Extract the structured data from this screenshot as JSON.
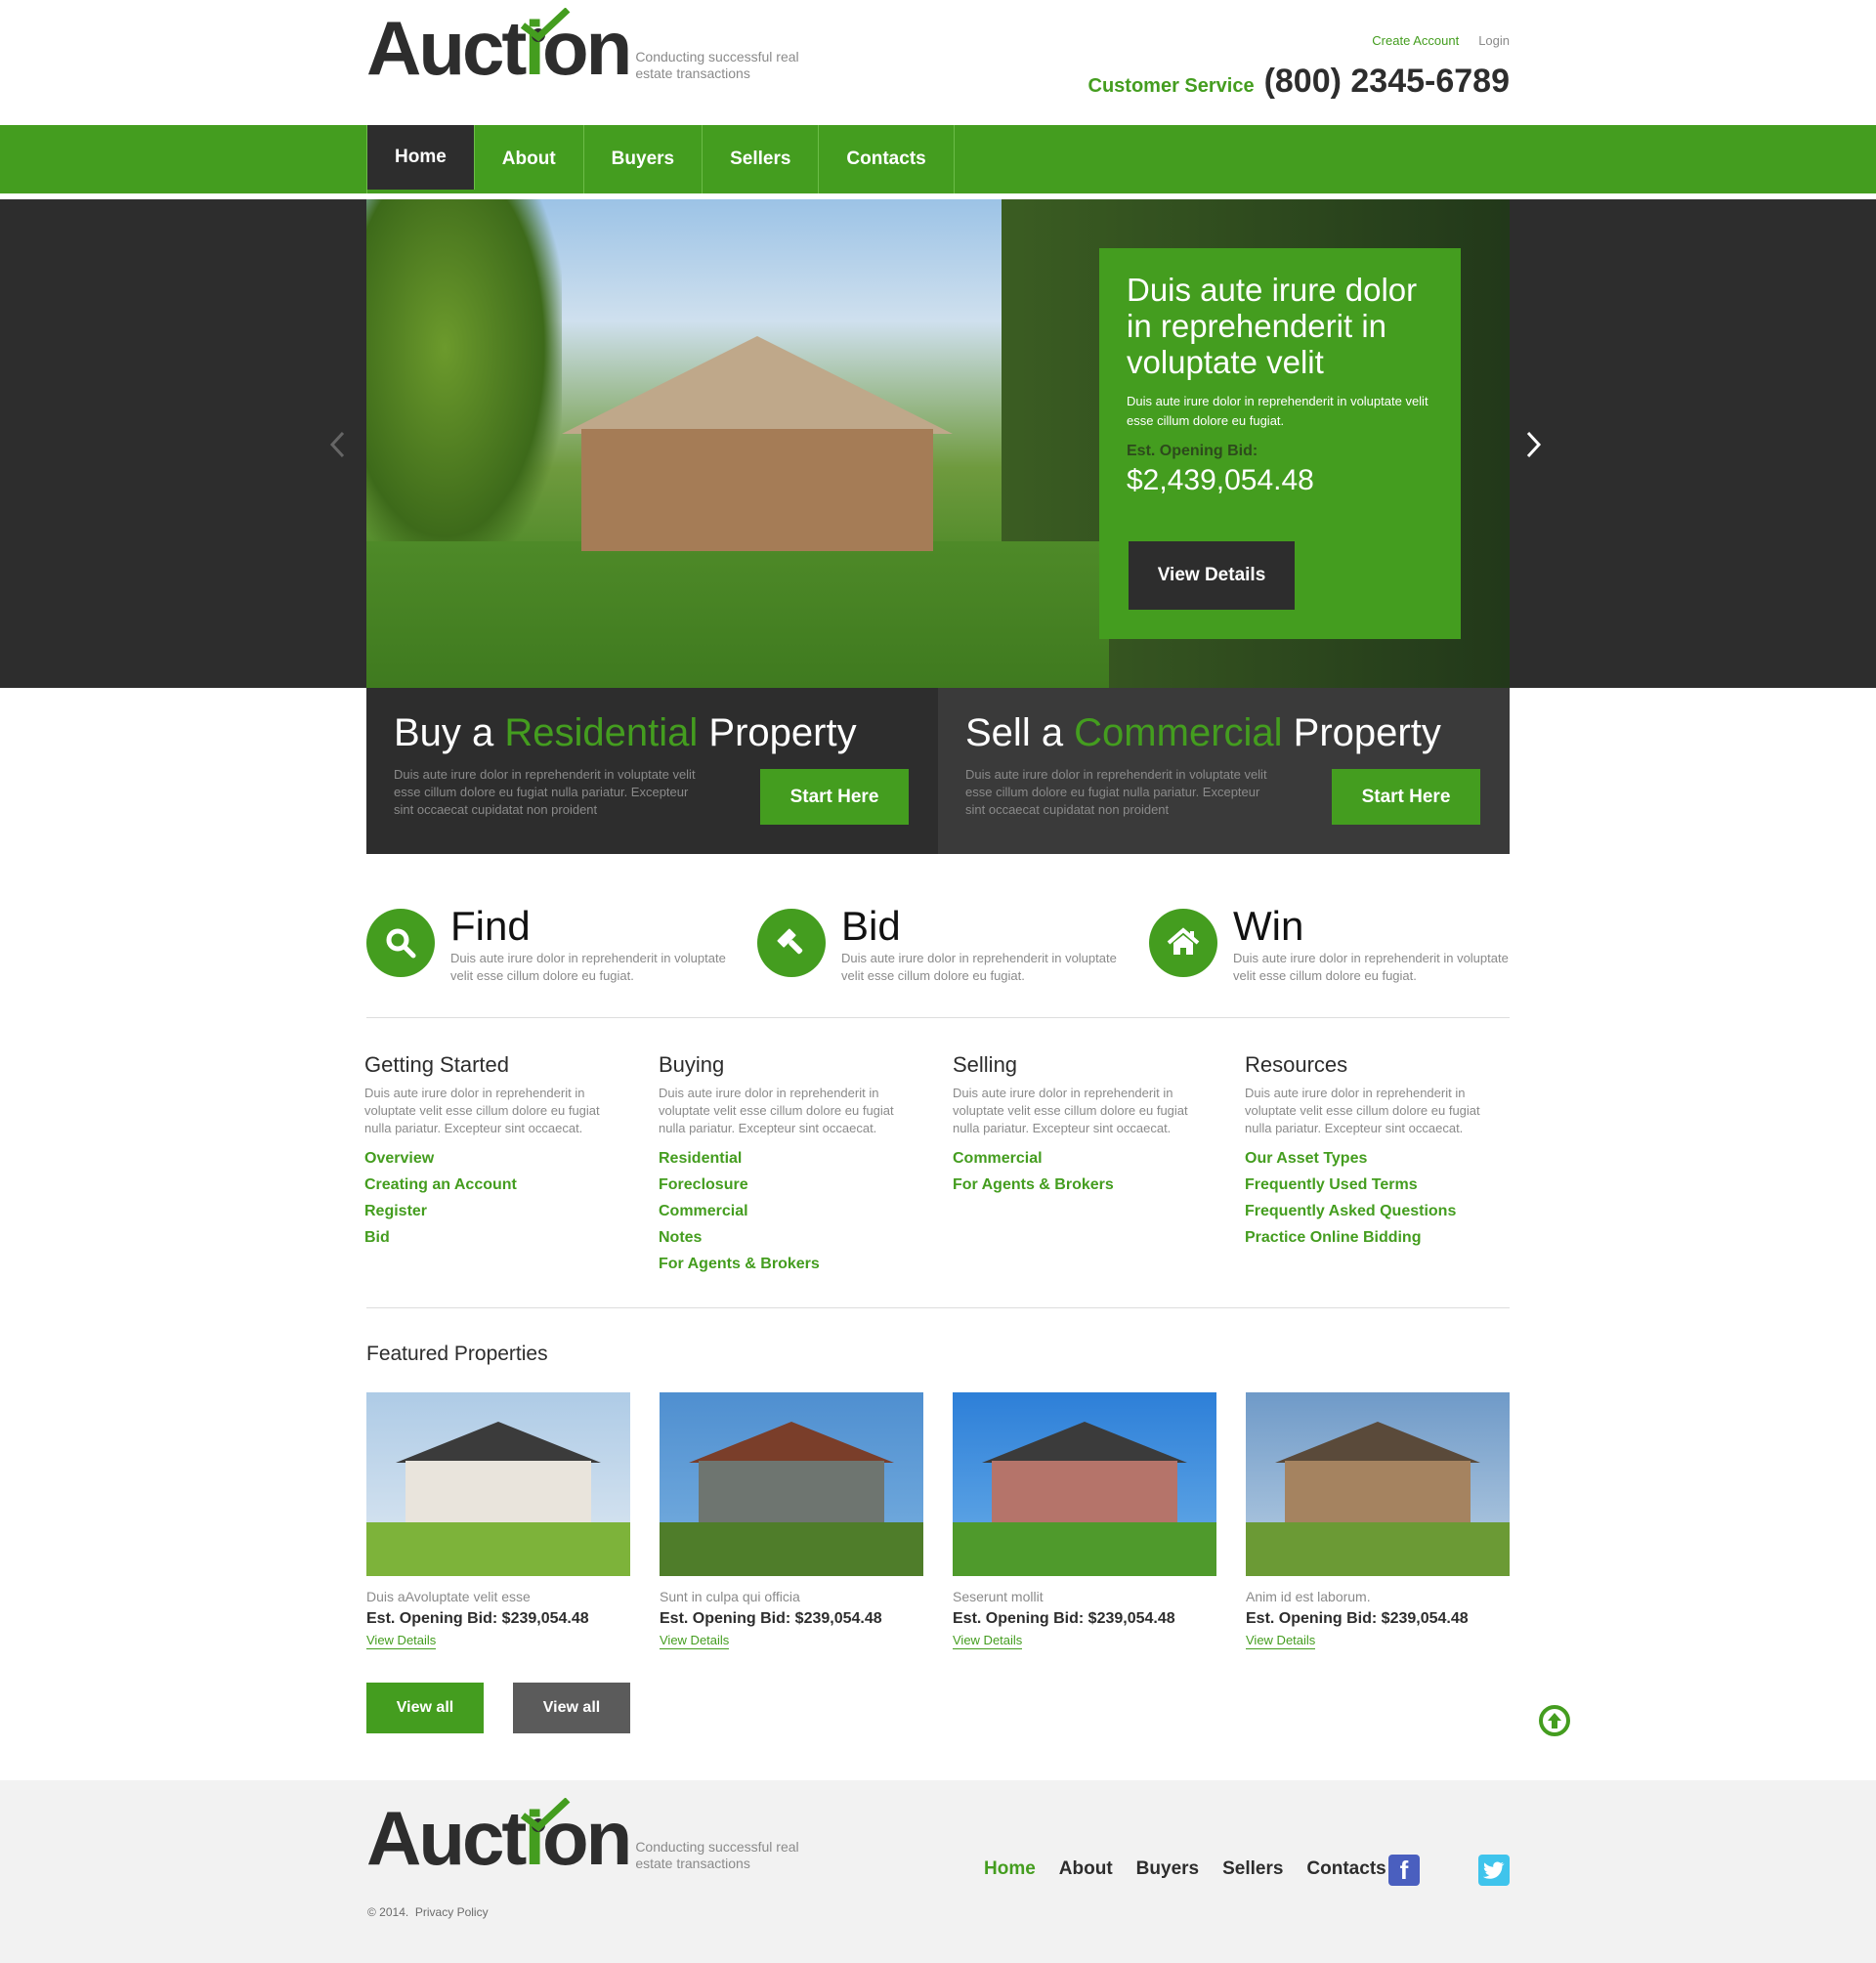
{
  "brand": {
    "logo_main": "Auct",
    "logo_i": "i",
    "logo_end": "on",
    "tagline_line1": "Conducting successful real",
    "tagline_line2": "estate transactions"
  },
  "header": {
    "create_account": "Create Account",
    "login": "Login",
    "customer_service_label": "Customer Service",
    "phone": "(800) 2345-6789"
  },
  "nav": {
    "items": [
      {
        "label": "Home",
        "active": true
      },
      {
        "label": "About"
      },
      {
        "label": "Buyers"
      },
      {
        "label": "Sellers"
      },
      {
        "label": "Contacts"
      }
    ]
  },
  "hero": {
    "title": "Duis aute irure dolor in reprehenderit in voluptate velit",
    "description": "Duis aute irure dolor in reprehenderit in voluptate velit esse cillum dolore eu fugiat.",
    "bid_label": "Est. Opening Bid:",
    "bid_value": "$2,439,054.48",
    "button": "View Details",
    "prev_icon": "chevron-left",
    "next_icon": "chevron-right"
  },
  "cta": {
    "buy": {
      "prefix": "Buy a ",
      "highlight": "Residential",
      "suffix": " Property",
      "description": "Duis aute irure dolor in reprehenderit in voluptate velit esse cillum dolore eu fugiat nulla pariatur. Excepteur sint occaecat cupidatat non proident",
      "button": "Start Here"
    },
    "sell": {
      "prefix": "Sell a ",
      "highlight": "Commercial",
      "suffix": " Property",
      "description": "Duis aute irure dolor in reprehenderit in voluptate velit esse cillum dolore eu fugiat nulla pariatur. Excepteur sint occaecat cupidatat non proident",
      "button": "Start Here"
    }
  },
  "features": [
    {
      "title": "Find",
      "icon": "search-icon",
      "description": "Duis aute irure dolor in reprehenderit in voluptate velit esse cillum dolore eu fugiat."
    },
    {
      "title": "Bid",
      "icon": "gavel-icon",
      "description": "Duis aute irure dolor in reprehenderit in voluptate velit esse cillum dolore eu fugiat."
    },
    {
      "title": "Win",
      "icon": "home-icon",
      "description": "Duis aute irure dolor in reprehenderit in voluptate velit esse cillum dolore eu fugiat."
    }
  ],
  "columns": [
    {
      "title": "Getting Started",
      "description": "Duis aute irure dolor in reprehenderit in voluptate velit esse cillum dolore eu fugiat nulla pariatur. Excepteur sint occaecat.",
      "links": [
        "Overview",
        "Creating an Account",
        "Register",
        "Bid"
      ]
    },
    {
      "title": "Buying",
      "description": "Duis aute irure dolor in reprehenderit in voluptate velit esse cillum dolore eu fugiat nulla pariatur. Excepteur sint occaecat.",
      "links": [
        "Residential",
        "Foreclosure",
        "Commercial",
        "Notes",
        "For Agents & Brokers"
      ]
    },
    {
      "title": "Selling",
      "description": "Duis aute irure dolor in reprehenderit in voluptate velit esse cillum dolore eu fugiat nulla pariatur. Excepteur sint occaecat.",
      "links": [
        "Commercial",
        "For Agents & Brokers"
      ]
    },
    {
      "title": "Resources",
      "description": "Duis aute irure dolor in reprehenderit in voluptate velit esse cillum dolore eu fugiat nulla pariatur. Excepteur sint occaecat.",
      "links": [
        "Our Asset Types",
        "Frequently Used Terms",
        "Frequently Asked Questions",
        "Practice Online Bidding"
      ]
    }
  ],
  "featured": {
    "heading": "Featured Properties",
    "properties": [
      {
        "name": "Duis aAvoluptate velit esse",
        "bid": "Est. Opening Bid: $239,054.48",
        "link": "View Details"
      },
      {
        "name": "Sunt in culpa qui officia",
        "bid": "Est. Opening Bid: $239,054.48",
        "link": "View Details"
      },
      {
        "name": "Seserunt mollit",
        "bid": "Est. Opening Bid: $239,054.48",
        "link": "View Details"
      },
      {
        "name": "Anim id est laborum.",
        "bid": "Est. Opening Bid: $239,054.48",
        "link": "View Details"
      }
    ],
    "view_all_primary": "View all",
    "view_all_secondary": "View all"
  },
  "footer": {
    "copyright": "© 2014.",
    "privacy": "Privacy Policy",
    "nav": [
      {
        "label": "Home",
        "active": true
      },
      {
        "label": "About"
      },
      {
        "label": "Buyers"
      },
      {
        "label": "Sellers"
      },
      {
        "label": "Contacts"
      }
    ],
    "social": [
      "facebook",
      "twitter"
    ]
  },
  "colors": {
    "accent": "#449d1f",
    "dark": "#2d2d2d",
    "muted_text": "#8a8a8a",
    "footer_bg": "#f2f2f2"
  }
}
